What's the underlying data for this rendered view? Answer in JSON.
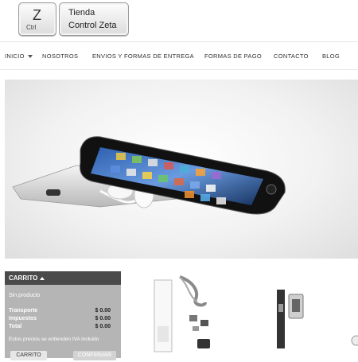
{
  "logo": {
    "key_letter": "Z",
    "key_sub": "Ctrl",
    "name_line1": "Tienda",
    "name_line2": "Control Zeta"
  },
  "nav": {
    "items": [
      "INICIO",
      "NOSOTROS",
      "ENVIOS Y FORMAS DE ENTREGA",
      "FORMAS DE PAGO",
      "CONTACTO",
      "BLOG"
    ]
  },
  "cart": {
    "title": "CARRITO",
    "empty_text": "Sin producto",
    "rows": [
      {
        "label": "Transporte",
        "value": "$ 0.00"
      },
      {
        "label": "Impuestos",
        "value": "$ 0.00"
      },
      {
        "label": "Total",
        "value": "$ 0.00"
      }
    ],
    "note": "Estos precios se entienden IVA incluido",
    "cart_button": "CARRITO",
    "confirm_button": "CONFIRMAR"
  },
  "colors": {
    "cart_bg": "#b5b5b5",
    "cart_header": "#4a4a4a",
    "nav_text": "#333333"
  }
}
